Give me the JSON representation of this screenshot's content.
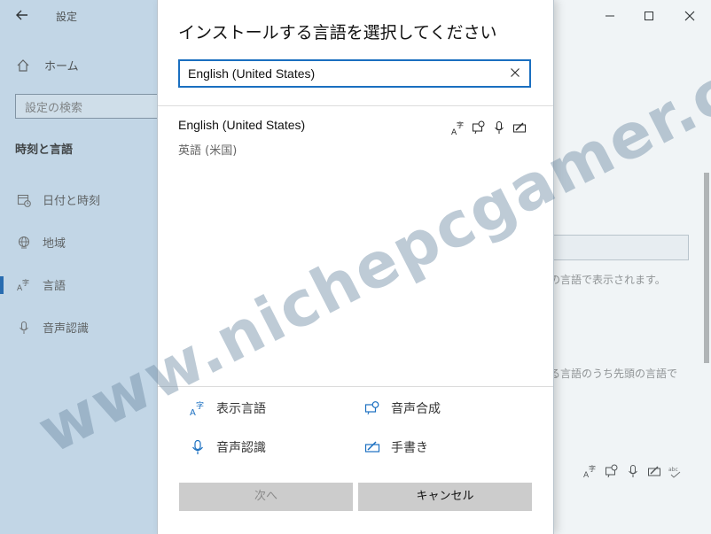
{
  "settings": {
    "title": "設定",
    "home_label": "ホーム",
    "search_placeholder": "設定の検索",
    "section_title": "時刻と言語",
    "nav": [
      {
        "label": "日付と時刻",
        "icon": "calendar-clock-icon"
      },
      {
        "label": "地域",
        "icon": "globe-icon"
      },
      {
        "label": "言語",
        "icon": "language-icon"
      },
      {
        "label": "音声認識",
        "icon": "microphone-icon"
      }
    ],
    "right_text_1": "の言語で表示されます。",
    "right_text_2": "る言語のうち先頭の言語で"
  },
  "dialog": {
    "title": "インストールする言語を選択してください",
    "search_value": "English (United States)",
    "result": {
      "name": "English (United States)",
      "native": "英語 (米国)"
    },
    "legend": {
      "display_language": "表示言語",
      "text_to_speech": "音声合成",
      "speech_recognition": "音声認識",
      "handwriting": "手書き"
    },
    "next_button": "次へ",
    "cancel_button": "キャンセル"
  },
  "watermark": "www.nichepcgamer.com",
  "colors": {
    "accent": "#1a6fc0",
    "sidebar_bg": "#cfe0ee",
    "button_bg": "#cccccc"
  }
}
